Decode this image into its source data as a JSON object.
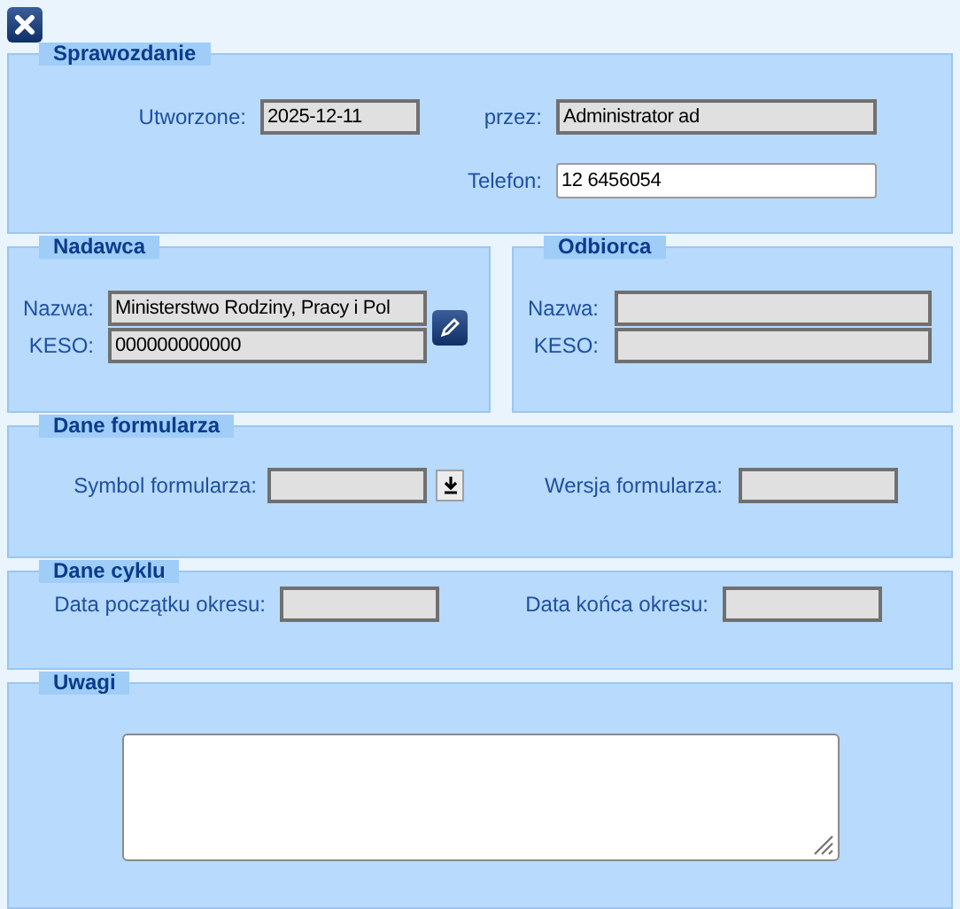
{
  "sprawozdanie": {
    "title": "Sprawozdanie",
    "fields": [
      {
        "label": "Utworzone:",
        "value": "2025-12-11",
        "readonly": true
      },
      {
        "label": "przez:",
        "value": "Administrator ad",
        "readonly": true
      },
      {
        "label": "Telefon:",
        "value": "12 6456054",
        "readonly": false
      }
    ]
  },
  "nadawca": {
    "title": "Nadawca",
    "fields": [
      {
        "label": "Nazwa:",
        "value": "Ministerstwo Rodziny, Pracy i Pol",
        "readonly": true
      },
      {
        "label": "KESO:",
        "value": "000000000000",
        "readonly": true
      }
    ]
  },
  "odbiorca": {
    "title": "Odbiorca",
    "fields": [
      {
        "label": "Nazwa:",
        "readonly": true
      },
      {
        "label": "KESO:",
        "readonly": true
      }
    ]
  },
  "dane_formularza": {
    "title": "Dane formularza",
    "fields": [
      {
        "label": "Symbol formularza:",
        "readonly": true
      },
      {
        "label": "Wersja formularza:",
        "readonly": true
      }
    ]
  },
  "dane_cyklu": {
    "title": "Dane cyklu",
    "fields": [
      {
        "label": "Data początku okresu:",
        "readonly": true
      },
      {
        "label": "Data końca okresu:",
        "readonly": true
      }
    ]
  },
  "uwagi": {
    "title": "Uwagi"
  }
}
